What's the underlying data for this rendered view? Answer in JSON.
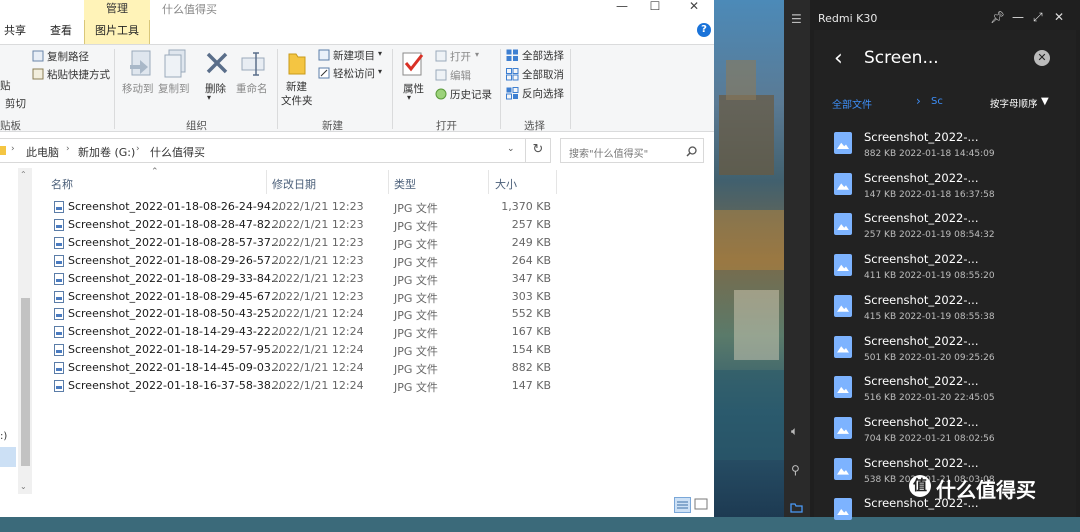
{
  "explorer": {
    "tabs": {
      "share": "共享",
      "view": "查看",
      "manage": "管理",
      "picture_tools": "图片工具"
    },
    "window_title": "什么值得买",
    "window_buttons": {
      "minimize": "—",
      "maximize": "☐",
      "close": "✕"
    },
    "help": "?",
    "ribbon": {
      "clipboard": {
        "paste": "贴",
        "copy_path": "复制路径",
        "paste_shortcut": "粘贴快捷方式",
        "cut": "剪切",
        "group": "贴板"
      },
      "organize": {
        "move_to": "移动到",
        "copy_to": "复制到",
        "delete": "删除",
        "rename": "重命名",
        "group": "组织"
      },
      "new": {
        "new_folder_line1": "新建",
        "new_folder_line2": "文件夹",
        "new_item": "新建项目",
        "easy_access": "轻松访问",
        "group": "新建"
      },
      "open": {
        "properties": "属性",
        "open": "打开",
        "edit": "编辑",
        "history": "历史记录",
        "group": "打开"
      },
      "select": {
        "select_all": "全部选择",
        "select_none": "全部取消",
        "invert": "反向选择",
        "group": "选择"
      }
    },
    "address": {
      "pc": "此电脑",
      "drive": "新加卷 (G:)",
      "folder": "什么值得买",
      "refresh": "↻"
    },
    "search_placeholder": "搜索\"什么值得买\"",
    "columns": {
      "name": "名称",
      "date": "修改日期",
      "type": "类型",
      "size": "大小"
    },
    "files": [
      {
        "name": "Screenshot_2022-01-18-08-26-24-94...",
        "date": "2022/1/21 12:23",
        "type": "JPG 文件",
        "size": "1,370 KB"
      },
      {
        "name": "Screenshot_2022-01-18-08-28-47-82...",
        "date": "2022/1/21 12:23",
        "type": "JPG 文件",
        "size": "257 KB"
      },
      {
        "name": "Screenshot_2022-01-18-08-28-57-37...",
        "date": "2022/1/21 12:23",
        "type": "JPG 文件",
        "size": "249 KB"
      },
      {
        "name": "Screenshot_2022-01-18-08-29-26-57...",
        "date": "2022/1/21 12:23",
        "type": "JPG 文件",
        "size": "264 KB"
      },
      {
        "name": "Screenshot_2022-01-18-08-29-33-84...",
        "date": "2022/1/21 12:23",
        "type": "JPG 文件",
        "size": "347 KB"
      },
      {
        "name": "Screenshot_2022-01-18-08-29-45-67...",
        "date": "2022/1/21 12:23",
        "type": "JPG 文件",
        "size": "303 KB"
      },
      {
        "name": "Screenshot_2022-01-18-08-50-43-25...",
        "date": "2022/1/21 12:24",
        "type": "JPG 文件",
        "size": "552 KB"
      },
      {
        "name": "Screenshot_2022-01-18-14-29-43-22...",
        "date": "2022/1/21 12:24",
        "type": "JPG 文件",
        "size": "167 KB"
      },
      {
        "name": "Screenshot_2022-01-18-14-29-57-95...",
        "date": "2022/1/21 12:24",
        "type": "JPG 文件",
        "size": "154 KB"
      },
      {
        "name": "Screenshot_2022-01-18-14-45-09-03...",
        "date": "2022/1/21 12:24",
        "type": "JPG 文件",
        "size": "882 KB"
      },
      {
        "name": "Screenshot_2022-01-18-16-37-58-38...",
        "date": "2022/1/21 12:24",
        "type": "JPG 文件",
        "size": "147 KB"
      }
    ]
  },
  "phone": {
    "title": "Redmi K30",
    "folder_title": "Screen...",
    "breadcrumb_all": "全部文件",
    "breadcrumb_current": "Sc",
    "sort_label": "按字母顺序",
    "items": [
      {
        "name": "Screenshot_2022-...",
        "meta": "882 KB   2022-01-18 14:45:09"
      },
      {
        "name": "Screenshot_2022-...",
        "meta": "147 KB   2022-01-18 16:37:58"
      },
      {
        "name": "Screenshot_2022-...",
        "meta": "257 KB   2022-01-19 08:54:32"
      },
      {
        "name": "Screenshot_2022-...",
        "meta": "411 KB   2022-01-19 08:55:20"
      },
      {
        "name": "Screenshot_2022-...",
        "meta": "415 KB   2022-01-19 08:55:38"
      },
      {
        "name": "Screenshot_2022-...",
        "meta": "501 KB   2022-01-20 09:25:26"
      },
      {
        "name": "Screenshot_2022-...",
        "meta": "516 KB   2022-01-20 22:45:05"
      },
      {
        "name": "Screenshot_2022-...",
        "meta": "704 KB   2022-01-21 08:02:56"
      },
      {
        "name": "Screenshot_2022-...",
        "meta": "538 KB   2022-01-21 08:03:08"
      },
      {
        "name": "Screenshot_2022-...",
        "meta": ""
      }
    ]
  },
  "watermark": "什么值得买",
  "watermark_logo": "值"
}
